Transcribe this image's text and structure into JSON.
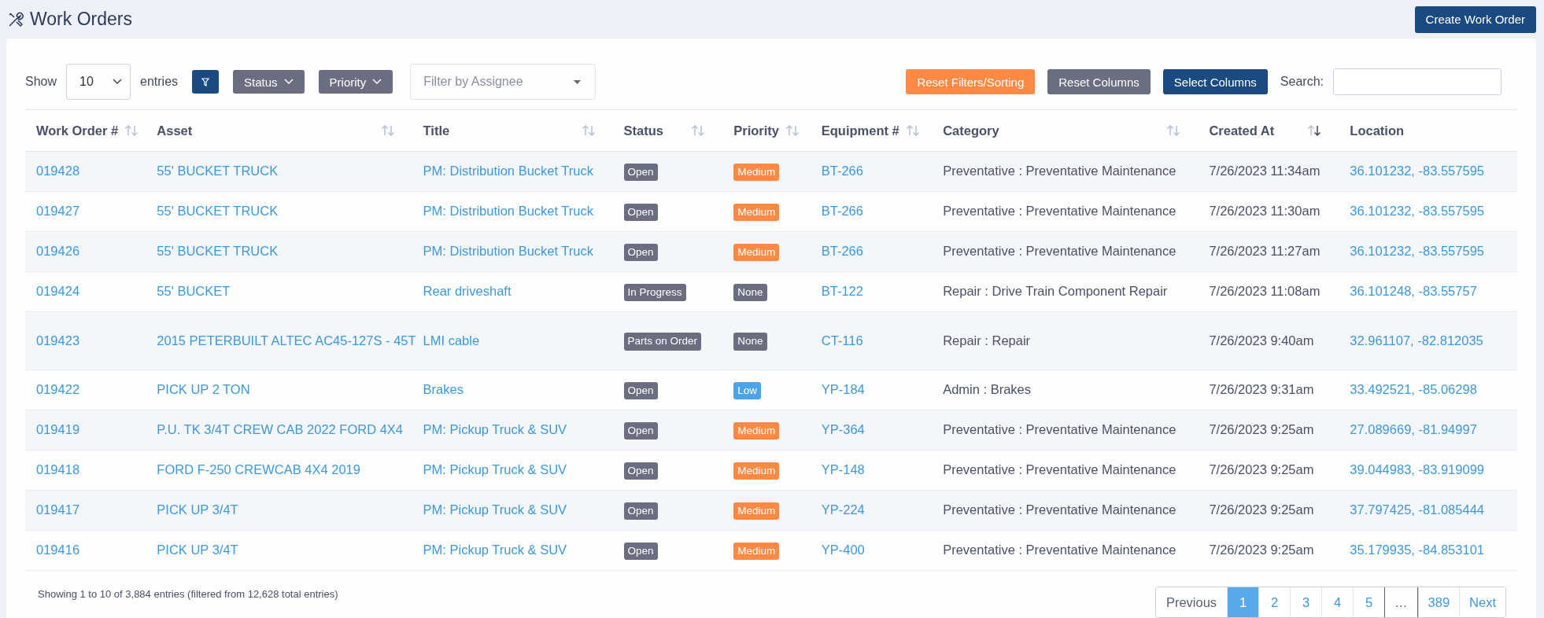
{
  "page": {
    "title": "Work Orders",
    "create_button": "Create Work Order"
  },
  "toolbar": {
    "show_label": "Show",
    "page_size": "10",
    "entries_label": "entries",
    "status_filter": "Status",
    "priority_filter": "Priority",
    "assignee_placeholder": "Filter by Assignee",
    "reset_filters": "Reset Filters/Sorting",
    "reset_columns": "Reset Columns",
    "select_columns": "Select Columns",
    "search_label": "Search:"
  },
  "table": {
    "columns": [
      {
        "label": "Work Order #",
        "sortable": true,
        "sorted_desc": false
      },
      {
        "label": "Asset",
        "sortable": true,
        "sorted_desc": false
      },
      {
        "label": "Title",
        "sortable": true,
        "sorted_desc": false
      },
      {
        "label": "Status",
        "sortable": true,
        "sorted_desc": false
      },
      {
        "label": "Priority",
        "sortable": true,
        "sorted_desc": false
      },
      {
        "label": "Equipment #",
        "sortable": true,
        "sorted_desc": false
      },
      {
        "label": "Category",
        "sortable": true,
        "sorted_desc": false
      },
      {
        "label": "Created At",
        "sortable": true,
        "sorted_desc": true
      },
      {
        "label": "Location",
        "sortable": false
      }
    ],
    "rows": [
      {
        "work_order": "019428",
        "asset": "55' BUCKET TRUCK",
        "title": "PM: Distribution Bucket Truck",
        "status": {
          "text": "Open",
          "color": "#6b6e80"
        },
        "priority": {
          "text": "Medium",
          "color": "#fd8a44"
        },
        "equipment": "BT-266",
        "category": "Preventative : Preventative Maintenance",
        "created_at": "7/26/2023 11:34am",
        "location": "36.101232, -83.557595"
      },
      {
        "work_order": "019427",
        "asset": "55' BUCKET TRUCK",
        "title": "PM: Distribution Bucket Truck",
        "status": {
          "text": "Open",
          "color": "#6b6e80"
        },
        "priority": {
          "text": "Medium",
          "color": "#fd8a44"
        },
        "equipment": "BT-266",
        "category": "Preventative : Preventative Maintenance",
        "created_at": "7/26/2023 11:30am",
        "location": "36.101232, -83.557595"
      },
      {
        "work_order": "019426",
        "asset": "55' BUCKET TRUCK",
        "title": "PM: Distribution Bucket Truck",
        "status": {
          "text": "Open",
          "color": "#6b6e80"
        },
        "priority": {
          "text": "Medium",
          "color": "#fd8a44"
        },
        "equipment": "BT-266",
        "category": "Preventative : Preventative Maintenance",
        "created_at": "7/26/2023 11:27am",
        "location": "36.101232, -83.557595"
      },
      {
        "work_order": "019424",
        "asset": "55' BUCKET",
        "title": "Rear driveshaft",
        "status": {
          "text": "In Progress",
          "color": "#6b6e80"
        },
        "priority": {
          "text": "None",
          "color": "#6b6e80"
        },
        "equipment": "BT-122",
        "category": "Repair : Drive Train Component Repair",
        "created_at": "7/26/2023 11:08am",
        "location": "36.101248, -83.55757"
      },
      {
        "work_order": "019423",
        "asset": "2015 PETERBUILT ALTEC AC45-127S - 45T",
        "title": "LMI cable",
        "status": {
          "text": "Parts on Order",
          "color": "#6b6e80"
        },
        "priority": {
          "text": "None",
          "color": "#6b6e80"
        },
        "equipment": "CT-116",
        "category": "Repair : Repair",
        "created_at": "7/26/2023 9:40am",
        "location": "32.961107, -82.812035"
      },
      {
        "work_order": "019422",
        "asset": "PICK UP 2 TON",
        "title": "Brakes",
        "status": {
          "text": "Open",
          "color": "#6b6e80"
        },
        "priority": {
          "text": "Low",
          "color": "#4ba4e9"
        },
        "equipment": "YP-184",
        "category": "Admin : Brakes",
        "created_at": "7/26/2023 9:31am",
        "location": "33.492521, -85.06298"
      },
      {
        "work_order": "019419",
        "asset": "P.U. TK 3/4T CREW CAB 2022 FORD 4X4",
        "title": "PM: Pickup Truck & SUV",
        "status": {
          "text": "Open",
          "color": "#6b6e80"
        },
        "priority": {
          "text": "Medium",
          "color": "#fd8a44"
        },
        "equipment": "YP-364",
        "category": "Preventative : Preventative Maintenance",
        "created_at": "7/26/2023 9:25am",
        "location": "27.089669, -81.94997"
      },
      {
        "work_order": "019418",
        "asset": "FORD F-250 CREWCAB 4X4 2019",
        "title": "PM: Pickup Truck & SUV",
        "status": {
          "text": "Open",
          "color": "#6b6e80"
        },
        "priority": {
          "text": "Medium",
          "color": "#fd8a44"
        },
        "equipment": "YP-148",
        "category": "Preventative : Preventative Maintenance",
        "created_at": "7/26/2023 9:25am",
        "location": "39.044983, -83.919099"
      },
      {
        "work_order": "019417",
        "asset": "PICK UP 3/4T",
        "title": "PM: Pickup Truck & SUV",
        "status": {
          "text": "Open",
          "color": "#6b6e80"
        },
        "priority": {
          "text": "Medium",
          "color": "#fd8a44"
        },
        "equipment": "YP-224",
        "category": "Preventative : Preventative Maintenance",
        "created_at": "7/26/2023 9:25am",
        "location": "37.797425, -81.085444"
      },
      {
        "work_order": "019416",
        "asset": "PICK UP 3/4T",
        "title": "PM: Pickup Truck & SUV",
        "status": {
          "text": "Open",
          "color": "#6b6e80"
        },
        "priority": {
          "text": "Medium",
          "color": "#fd8a44"
        },
        "equipment": "YP-400",
        "category": "Preventative : Preventative Maintenance",
        "created_at": "7/26/2023 9:25am",
        "location": "35.179935, -84.853101"
      }
    ]
  },
  "footer": {
    "info": "Showing 1 to 10 of 3,884 entries (filtered from 12,628 total entries)"
  },
  "pagination": {
    "previous": "Previous",
    "next": "Next",
    "pages": [
      {
        "label": "1",
        "kind": "page",
        "selected": true
      },
      {
        "label": "2",
        "kind": "page",
        "selected": false
      },
      {
        "label": "3",
        "kind": "page",
        "selected": false
      },
      {
        "label": "4",
        "kind": "page",
        "selected": false
      },
      {
        "label": "5",
        "kind": "page",
        "selected": false
      },
      {
        "label": "…",
        "kind": "ellipsis"
      },
      {
        "label": "389",
        "kind": "page",
        "selected": false
      }
    ]
  }
}
